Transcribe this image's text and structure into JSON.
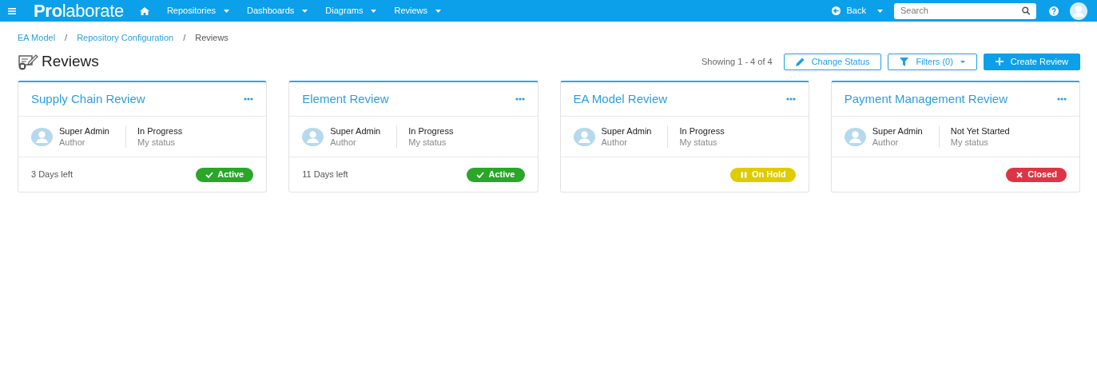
{
  "navbar": {
    "logo": "**Pro**laborate",
    "menus": [
      {
        "label": "Repositories"
      },
      {
        "label": "Dashboards"
      },
      {
        "label": "Diagrams"
      },
      {
        "label": "Reviews"
      }
    ],
    "back": "Back",
    "search": {
      "placeholder": "Search"
    }
  },
  "breadcrumb": [
    {
      "kind": "link",
      "label": "EA Model",
      "current": false
    },
    {
      "kind": "separator",
      "label": "/"
    },
    {
      "kind": "link",
      "label": "Repository Configuration",
      "current": false
    },
    {
      "kind": "separator",
      "label": "/"
    },
    {
      "kind": "link",
      "label": "Reviews",
      "current": true
    }
  ],
  "page_title": "Reviews",
  "toolbar": {
    "showing": "Showing 1 - 4 of 4",
    "change_status": "Change Status",
    "filters": "Filters (0)",
    "create": "Create Review"
  },
  "reviews": [
    {
      "title": "Supply Chain Review",
      "author": "Super Admin",
      "author_label": "Author",
      "my_status": "In Progress",
      "my_status_label": "My status",
      "days_left": "3 Days left",
      "status": {
        "kind": "active",
        "label": "Active"
      }
    },
    {
      "title": "Element Review",
      "author": "Super Admin",
      "author_label": "Author",
      "my_status": "In Progress",
      "my_status_label": "My status",
      "days_left": "11 Days left",
      "status": {
        "kind": "active",
        "label": "Active"
      }
    },
    {
      "title": "EA Model Review",
      "author": "Super Admin",
      "author_label": "Author",
      "my_status": "In Progress",
      "my_status_label": "My status",
      "status": {
        "kind": "on_hold",
        "label": "On Hold"
      }
    },
    {
      "title": "Payment Management Review",
      "author": "Super Admin",
      "author_label": "Author",
      "my_status": "Not Yet Started",
      "my_status_label": "My status",
      "status": {
        "kind": "closed",
        "label": "Closed"
      }
    }
  ]
}
